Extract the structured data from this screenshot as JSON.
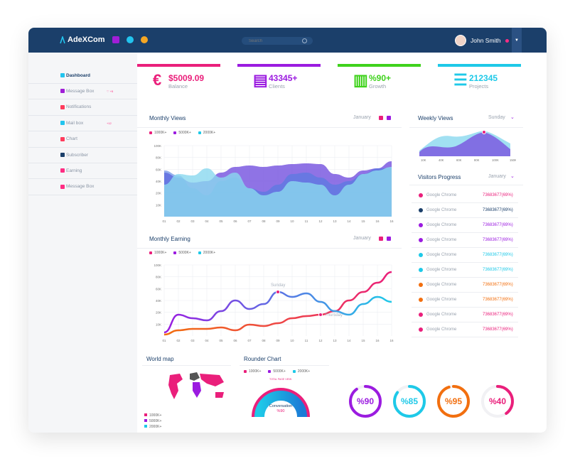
{
  "app": {
    "logo_text": "AdeXCom"
  },
  "header": {
    "search_placeholder": "Search",
    "user_name": "John Smith",
    "icons": [
      "mail-icon",
      "alarm-icon",
      "fish-icon"
    ]
  },
  "sidebar": {
    "items": [
      {
        "label": "Dashboard",
        "icon": "heart-icon",
        "color": "#22c4ee",
        "active": true,
        "badge": ""
      },
      {
        "label": "Message Box",
        "icon": "monitor-icon",
        "color": "#a01ed7",
        "active": false,
        "badge": "♡ +5"
      },
      {
        "label": "Notifications",
        "icon": "mail-icon",
        "color": "#ff3b5c",
        "active": false,
        "badge": ""
      },
      {
        "label": "Mail box",
        "icon": "drop-icon",
        "color": "#22c4ee",
        "active": false,
        "badge": "+12"
      },
      {
        "label": "Chart",
        "icon": "pie-icon",
        "color": "#ff3b5c",
        "active": false,
        "badge": ""
      },
      {
        "label": "Subscriber",
        "icon": "share-icon",
        "color": "#1b3f6a",
        "active": false,
        "badge": ""
      },
      {
        "label": "Earning",
        "icon": "heart-icon",
        "color": "#ff2d83",
        "active": false,
        "badge": ""
      },
      {
        "label": "Message Box",
        "icon": "heart-icon",
        "color": "#ff2d83",
        "active": false,
        "badge": ""
      }
    ]
  },
  "stats": [
    {
      "icon": "€",
      "value": "$5009.09",
      "label": "Balance",
      "color": "#ea1f7b"
    },
    {
      "icon": "▤",
      "value": "43345+",
      "label": "Clients",
      "color": "#9b1be0"
    },
    {
      "icon": "▥",
      "value": "%90+",
      "label": "Growth",
      "color": "#3fd21c"
    },
    {
      "icon": "☰",
      "value": "212345",
      "label": "Projects",
      "color": "#1ec9e8"
    }
  ],
  "monthly_views": {
    "title": "Monthly Views",
    "month": "January",
    "legend": [
      "1000K+",
      "5000K+",
      "2000K+"
    ],
    "yticks": [
      "100K",
      "80K",
      "60K",
      "40K",
      "20K",
      "10K"
    ],
    "xticks": [
      "01",
      "02",
      "03",
      "04",
      "05",
      "06",
      "07",
      "08",
      "09",
      "10",
      "11",
      "12",
      "13",
      "14",
      "15",
      "16",
      "16"
    ]
  },
  "monthly_earning": {
    "title": "Monthly Earning",
    "month": "January",
    "legend": [
      "1000K+",
      "5000K+",
      "2000K+"
    ],
    "yticks": [
      "100K",
      "80K",
      "60K",
      "40K",
      "20K",
      "10K"
    ],
    "xticks": [
      "01",
      "02",
      "03",
      "04",
      "05",
      "06",
      "07",
      "08",
      "09",
      "10",
      "11",
      "12",
      "13",
      "14",
      "15",
      "16",
      "16"
    ],
    "annotations": [
      "Sunday",
      "Thursday"
    ]
  },
  "weekly_views": {
    "title": "Weekly Views",
    "day": "Sunday",
    "xticks": [
      "10K",
      "40K",
      "60K",
      "80K",
      "100K",
      "150K"
    ]
  },
  "visitors": {
    "title": "Visitors Progress",
    "month": "January",
    "rows": [
      {
        "browser": "Google Chrome",
        "value": "73683677(69%)",
        "color": "#ea1f7b"
      },
      {
        "browser": "Google Chrome",
        "value": "73683677(69%)",
        "color": "#1b3f6a"
      },
      {
        "browser": "Google Chrome",
        "value": "73683677(69%)",
        "color": "#9b1be0"
      },
      {
        "browser": "Google Chrome",
        "value": "73683677(69%)",
        "color": "#9b1be0"
      },
      {
        "browser": "Google Chrome",
        "value": "73683677(69%)",
        "color": "#1ec9e8"
      },
      {
        "browser": "Google Chrome",
        "value": "73683677(69%)",
        "color": "#1ec9e8"
      },
      {
        "browser": "Google Chrome",
        "value": "73683677(69%)",
        "color": "#f26f0f"
      },
      {
        "browser": "Google Chrome",
        "value": "73683677(69%)",
        "color": "#f26f0f"
      },
      {
        "browser": "Google Chrome",
        "value": "73683677(69%)",
        "color": "#ea1f7b"
      },
      {
        "browser": "Google Chrome",
        "value": "73683677(69%)",
        "color": "#ea1f7b"
      }
    ]
  },
  "world_map": {
    "title": "World map",
    "legend": [
      "1000K+",
      "5000K+",
      "2000K+"
    ]
  },
  "rounder_chart": {
    "title": "Rounder Chart",
    "legend": [
      "1000K+",
      "5000K+",
      "2000K+"
    ],
    "caption": "TOTAL PAGE VIEW",
    "center_label": "Conversation",
    "center_value": "%90"
  },
  "rings": [
    {
      "label": "%90",
      "value": 0.9,
      "color": "#9b1be0"
    },
    {
      "label": "%85",
      "value": 0.85,
      "color": "#1ec9e8"
    },
    {
      "label": "%95",
      "value": 0.95,
      "color": "#f26f0f"
    },
    {
      "label": "%40",
      "value": 0.4,
      "color": "#ea1f7b"
    }
  ],
  "chart_data": [
    {
      "type": "area",
      "title": "Monthly Views",
      "categories": [
        "01",
        "02",
        "03",
        "04",
        "05",
        "06",
        "07",
        "08",
        "09",
        "10",
        "11",
        "12",
        "13",
        "14",
        "15",
        "16",
        "16"
      ],
      "ylim": [
        0,
        100
      ],
      "series": [
        {
          "name": "1000K+",
          "values": [
            62,
            55,
            48,
            50,
            62,
            70,
            72,
            70,
            72,
            74,
            75,
            74,
            60,
            55,
            65,
            68,
            78
          ]
        },
        {
          "name": "5000K+",
          "values": [
            45,
            60,
            58,
            68,
            55,
            62,
            40,
            30,
            35,
            50,
            48,
            45,
            30,
            45,
            60,
            65,
            70
          ]
        },
        {
          "name": "2000K+",
          "values": [
            65,
            58,
            40,
            30,
            50,
            55,
            40,
            35,
            45,
            60,
            62,
            55,
            45,
            50,
            60,
            68,
            68
          ]
        }
      ]
    },
    {
      "type": "line",
      "title": "Monthly Earning",
      "categories": [
        "01",
        "02",
        "03",
        "04",
        "05",
        "06",
        "07",
        "08",
        "09",
        "10",
        "11",
        "12",
        "13",
        "14",
        "15",
        "16",
        "16"
      ],
      "ylim": [
        0,
        100
      ],
      "series": [
        {
          "name": "1000K+",
          "values": [
            2,
            8,
            10,
            10,
            12,
            8,
            16,
            14,
            18,
            25,
            28,
            30,
            35,
            50,
            62,
            75,
            90
          ]
        },
        {
          "name": "5000K+",
          "values": [
            5,
            30,
            25,
            22,
            35,
            50,
            38,
            45,
            62,
            55,
            60,
            48,
            35,
            30,
            45,
            55,
            48
          ]
        },
        {
          "name": "2000K+",
          "values": [
            5,
            30,
            25,
            22,
            35,
            50,
            38,
            45,
            62,
            55,
            60,
            48,
            35,
            30,
            45,
            55,
            48
          ]
        }
      ]
    }
  ]
}
